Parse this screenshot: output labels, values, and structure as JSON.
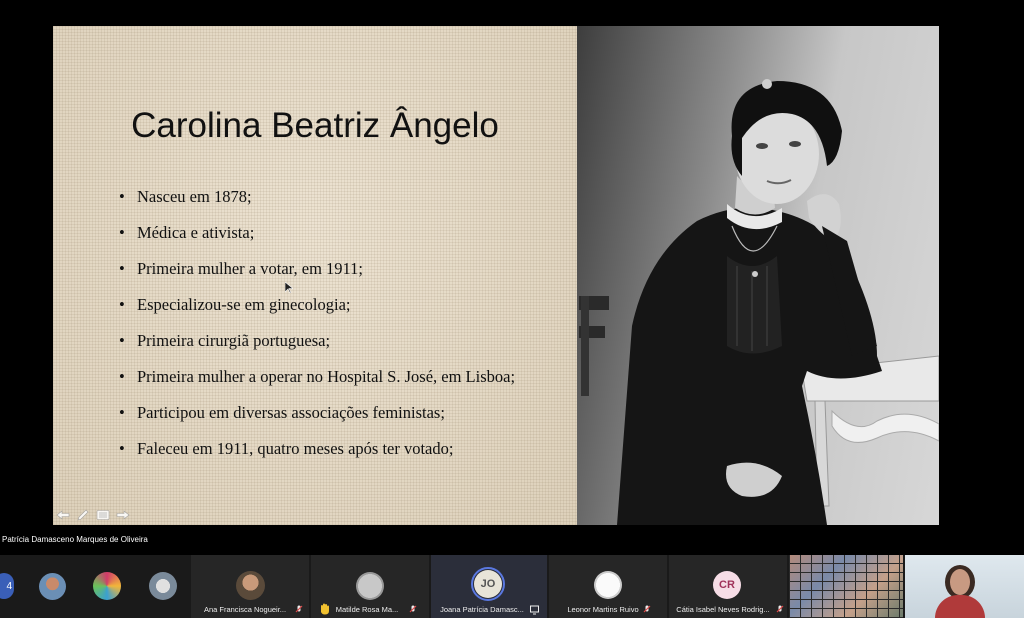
{
  "slide": {
    "title": "Carolina Beatriz Ângelo",
    "bullet_marker": "•",
    "bullets": [
      "Nasceu em 1878;",
      "Médica e ativista;",
      "Primeira mulher a votar, em 1911;",
      "Especializou-se em ginecologia;",
      "Primeira cirurgiã portuguesa;",
      "Primeira mulher a operar no Hospital S. José, em Lisboa;",
      "Participou em diversas associações feministas;",
      "Faleceu em 1911, quatro meses após ter votado;"
    ],
    "nav_icons": [
      "arrow-left-icon",
      "pen-icon",
      "menu-icon",
      "arrow-right-icon"
    ],
    "photo_icon": "portrait-photo"
  },
  "presenter": {
    "name": "Patrícia Damasceno Marques de Oliveira"
  },
  "participants": {
    "count_badge": "4",
    "tiles": [
      {
        "name": "Ana Francisca Nogueir...",
        "muted": true
      },
      {
        "name": "Matilde Rosa Ma...",
        "muted": true,
        "hand_raised": true
      },
      {
        "name": "Joana Patrícia Damasc...",
        "initials": "JO",
        "active_speaker": true
      },
      {
        "name": "Leonor Martins Ruivo",
        "muted": true
      },
      {
        "name": "Cátia Isabel Neves Rodrig...",
        "initials": "CR",
        "muted": true
      }
    ]
  },
  "colors": {
    "slide_bg": "#e6d9c2",
    "tile_bg": "#262626",
    "jo_avatar": "#e8e4d8",
    "cr_avatar": "#f6dde6",
    "cr_text": "#a0325a",
    "mute_icon": "#e04848",
    "hand_icon": "#f2c230"
  }
}
